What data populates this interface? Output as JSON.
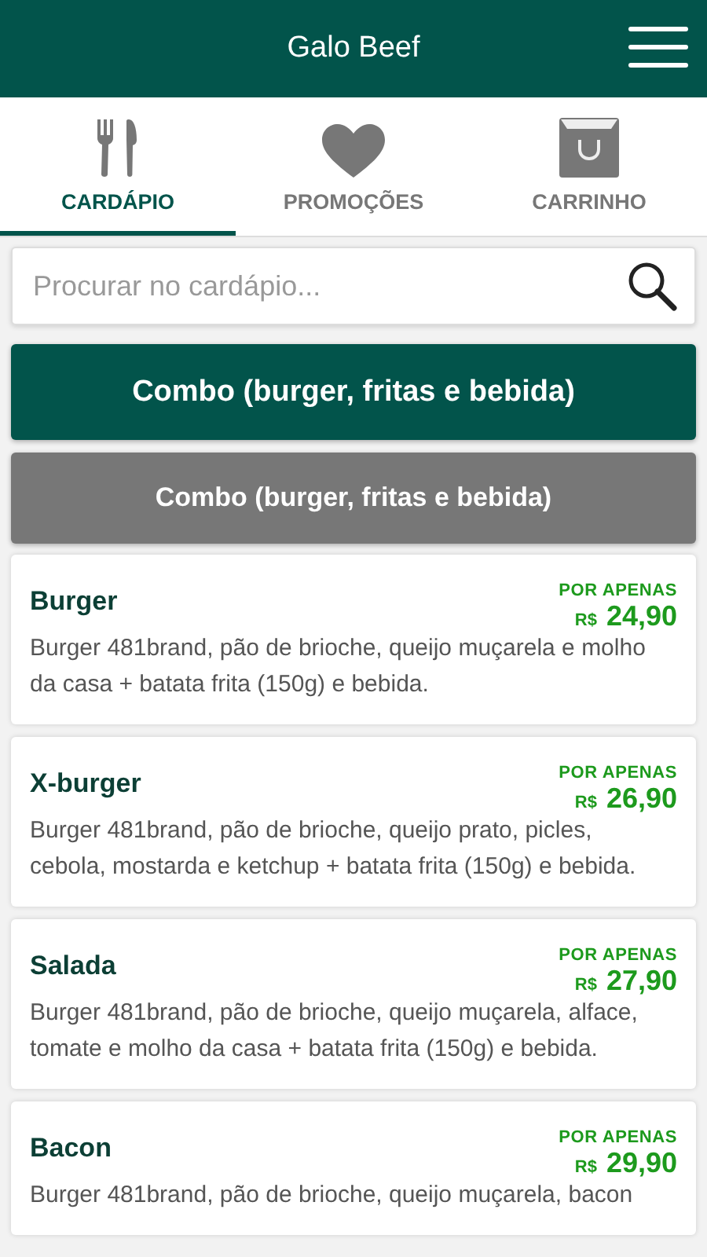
{
  "header": {
    "title": "Galo Beef"
  },
  "tabs": [
    {
      "label": "CARDÁPIO",
      "kind": "cutlery",
      "selected": true
    },
    {
      "label": "PROMOÇÕES",
      "kind": "heart",
      "selected": false
    },
    {
      "label": "CARRINHO",
      "kind": "bag",
      "selected": false
    }
  ],
  "search": {
    "placeholder": "Procurar no cardápio..."
  },
  "categories": [
    {
      "label": "Combo (burger, fritas e bebida)",
      "selected": true
    },
    {
      "label": "Combo (burger, fritas e bebida)",
      "selected": false
    }
  ],
  "items": [
    {
      "name": "Burger",
      "price_label": "POR APENAS",
      "currency": "R$",
      "price": "24,90",
      "description": "Burger 481brand, pão de brioche, queijo muçarela e molho da casa + batata frita (150g) e bebida."
    },
    {
      "name": "X-burger",
      "price_label": "POR APENAS",
      "currency": "R$",
      "price": "26,90",
      "description": "Burger 481brand, pão de brioche, queijo prato, picles, cebola, mostarda e ketchup + batata frita (150g) e bebida."
    },
    {
      "name": "Salada",
      "price_label": "POR APENAS",
      "currency": "R$",
      "price": "27,90",
      "description": "Burger 481brand, pão de brioche, queijo muçarela, alface, tomate e molho da casa + batata frita (150g) e bebida."
    },
    {
      "name": "Bacon",
      "price_label": "POR APENAS",
      "currency": "R$",
      "price": "29,90",
      "description": "Burger 481brand, pão de brioche, queijo muçarela, bacon"
    }
  ]
}
